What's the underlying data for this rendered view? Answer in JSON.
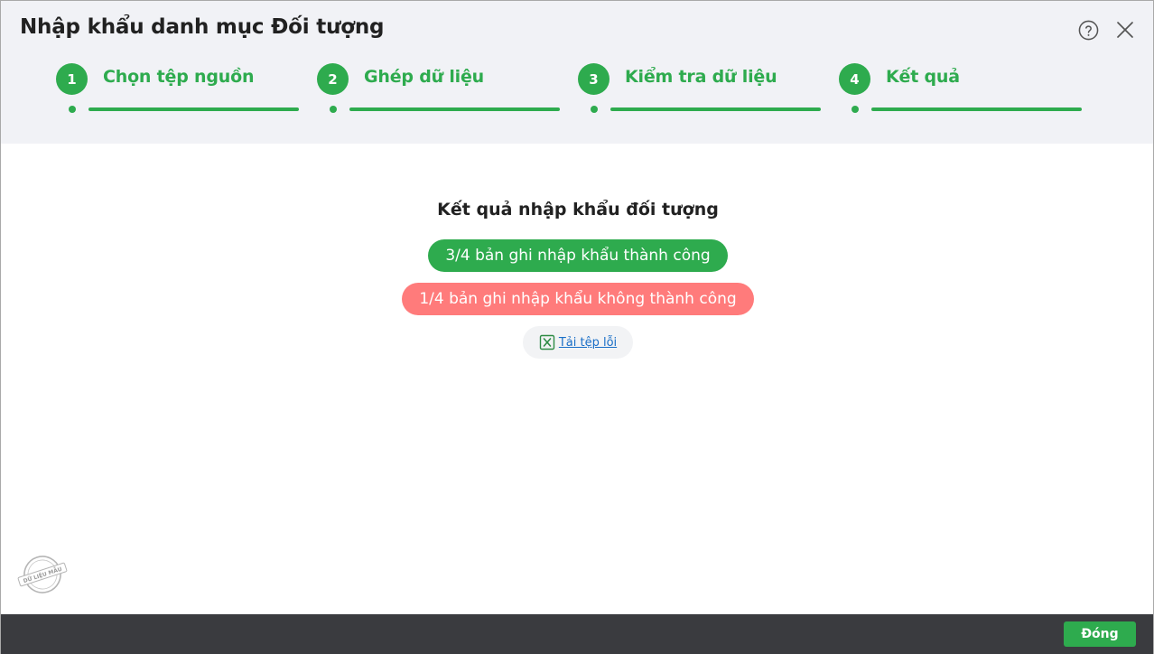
{
  "dialog": {
    "title": "Nhập khẩu danh mục Đối tượng",
    "icons": {
      "help": "help-circle-icon",
      "close": "close-icon"
    }
  },
  "steps": [
    {
      "number": "1",
      "label": "Chọn tệp nguồn"
    },
    {
      "number": "2",
      "label": "Ghép dữ liệu"
    },
    {
      "number": "3",
      "label": "Kiểm tra dữ liệu"
    },
    {
      "number": "4",
      "label": "Kết quả"
    }
  ],
  "result": {
    "title": "Kết quả nhập khẩu đối tượng",
    "success_text": "3/4 bản ghi nhập khẩu thành công",
    "fail_text": "1/4 bản ghi nhập khẩu không thành công",
    "download_label": "Tải tệp lỗi",
    "download_icon": "excel-file-icon"
  },
  "watermark": {
    "text": "DỮ LIỆU MẪU"
  },
  "footer": {
    "close_label": "Đóng"
  },
  "colors": {
    "accent": "#2eab4e",
    "fail": "#ff7b7b",
    "header_bg": "#f1f2f6",
    "footer_bg": "#3a3b3f",
    "link": "#1a6fc7"
  }
}
